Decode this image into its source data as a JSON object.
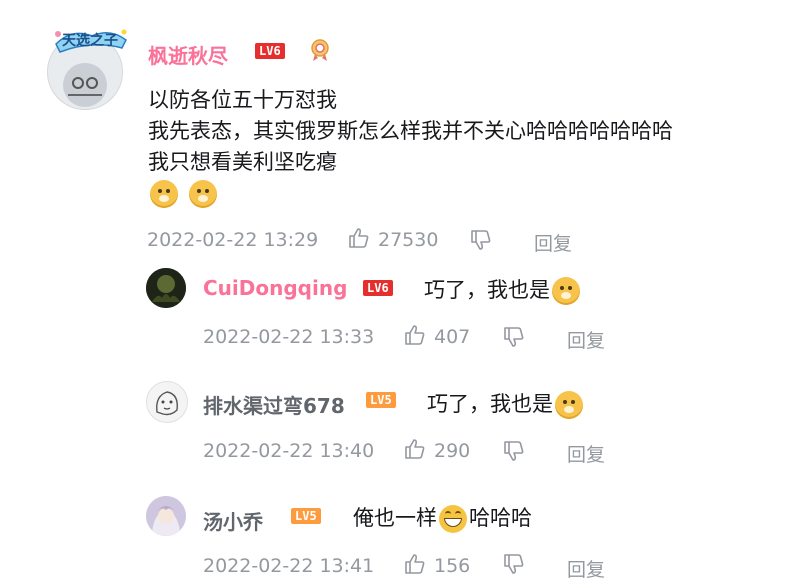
{
  "colors": {
    "username_pink": "#fb7299",
    "username_gray": "#61666d",
    "level6": "#e52e2e",
    "level5": "#ff9b3f",
    "meta": "#9499a0",
    "text": "#18191c"
  },
  "comment": {
    "user": "枫逝秋尽",
    "level": "LV6",
    "avatar_badge": "天选之子",
    "lines": [
      "以防各位五十万怼我",
      "我先表态，其实俄罗斯怎么样我并不关心哈哈哈哈哈哈哈",
      "我只想看美利坚吃瘪"
    ],
    "emojis": [
      "doge-emoji",
      "doge-emoji"
    ],
    "time": "2022-02-22 13:29",
    "likes": "27530",
    "reply_label": "回复"
  },
  "replies": [
    {
      "user": "CuiDongqing",
      "level": "LV6",
      "text": "巧了，我也是",
      "emoji": "doge-emoji",
      "time": "2022-02-22 13:33",
      "likes": "407",
      "reply_label": "回复"
    },
    {
      "user": "排水渠过弯678",
      "level": "LV5",
      "text": "巧了，我也是",
      "emoji": "doge-emoji",
      "time": "2022-02-22 13:40",
      "likes": "290",
      "reply_label": "回复"
    },
    {
      "user": "汤小乔",
      "level": "LV5",
      "text_before": "俺也一样",
      "emoji": "grin-emoji",
      "text_after": "哈哈哈",
      "time": "2022-02-22 13:41",
      "likes": "156",
      "reply_label": "回复"
    }
  ]
}
